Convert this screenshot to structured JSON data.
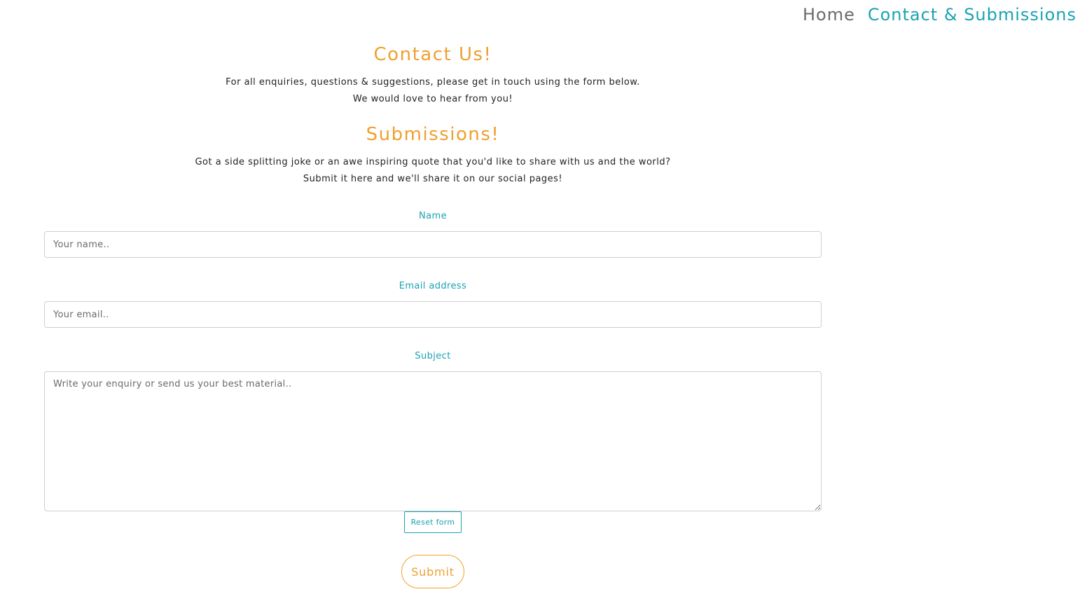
{
  "nav": {
    "home_label": "Home",
    "contact_label": "Contact & Submissions"
  },
  "contact": {
    "title": "Contact Us!",
    "line1": "For all enquiries, questions & suggestions, please get in touch using the form below.",
    "line2": "We would love to hear from you!"
  },
  "submissions": {
    "title": "Submissions!",
    "line1": "Got a side splitting joke or an awe inspiring quote that you'd like to share with us and the world?",
    "line2": "Submit it here and we'll share it on our social pages!"
  },
  "form": {
    "name_label": "Name",
    "name_placeholder": "Your name..",
    "name_value": "",
    "email_label": "Email address",
    "email_placeholder": "Your email..",
    "email_value": "",
    "subject_label": "Subject",
    "subject_placeholder": "Write your enquiry or send us your best material..",
    "subject_value": "",
    "reset_label": "Reset form",
    "submit_label": "Submit"
  },
  "colors": {
    "accent_orange": "#f0a030",
    "accent_teal": "#1ba3b3",
    "nav_gray": "#6b6b6b"
  }
}
